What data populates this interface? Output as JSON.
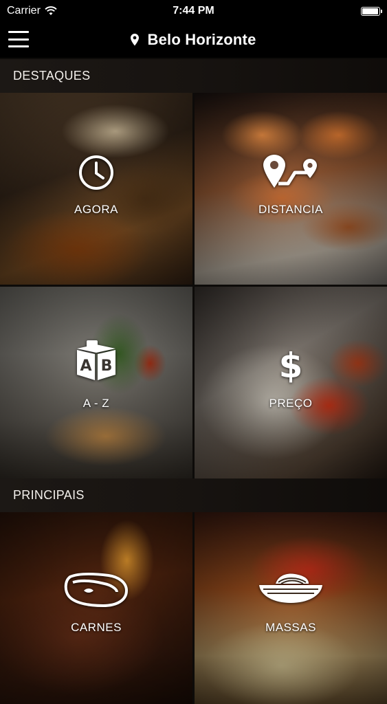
{
  "status_bar": {
    "carrier": "Carrier",
    "time": "7:44 PM",
    "wifi_icon": "wifi-icon",
    "battery_icon": "battery-icon",
    "battery_level": 0.95
  },
  "nav": {
    "menu_icon": "hamburger-menu-icon",
    "location_icon": "map-pin-icon",
    "city": "Belo Horizonte"
  },
  "sections": {
    "destaques": {
      "title": "DESTAQUES",
      "tiles": [
        {
          "label": "AGORA",
          "icon": "clock-icon"
        },
        {
          "label": "DISTANCIA",
          "icon": "route-distance-icon"
        },
        {
          "label": "A - Z",
          "icon": "alphabet-blocks-icon"
        },
        {
          "label": "PREÇO",
          "icon": "dollar-icon"
        }
      ]
    },
    "principais": {
      "title": "PRINCIPAIS",
      "tiles": [
        {
          "label": "CARNES",
          "icon": "steak-icon"
        },
        {
          "label": "MASSAS",
          "icon": "pasta-bowl-icon"
        }
      ]
    }
  }
}
